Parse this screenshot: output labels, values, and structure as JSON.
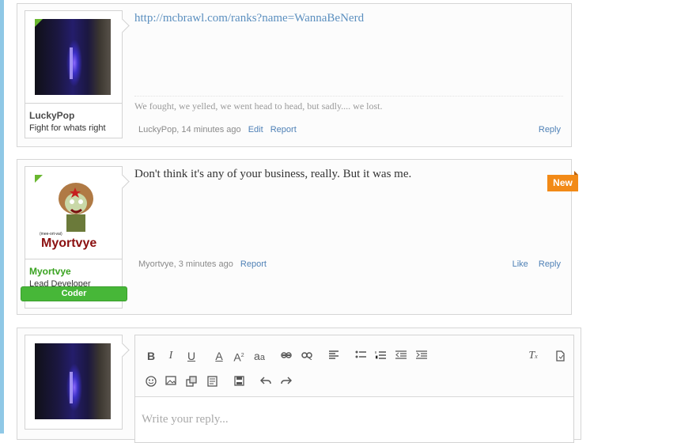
{
  "post1": {
    "username": "LuckyPop",
    "user_title": "Fight for whats right",
    "message_link": "http://mcbrawl.com/ranks?name=WannaBeNerd",
    "signature": "We fought, we yelled, we went head to head, but sadly.... we lost.",
    "meta_author_time": "LuckyPop, 14 minutes ago",
    "edit_label": "Edit",
    "report_label": "Report",
    "reply_label": "Reply"
  },
  "post2": {
    "username": "Myortvye",
    "user_title": "Lead Developer",
    "badge": "Coder",
    "message": "Don't think it's any of your business, really. But it was me.",
    "new_label": "New",
    "meta_author_time": "Myortvye, 3 minutes ago",
    "report_label": "Report",
    "like_label": "Like",
    "reply_label": "Reply",
    "avatar_text": "(mee-ort-vai) Myortvye"
  },
  "reply_editor": {
    "placeholder": "Write your reply...",
    "toolbar_icons": [
      "bold-icon",
      "italic-icon",
      "underline-icon",
      "text-color-icon",
      "font-size-icon",
      "font-family-icon",
      "link-icon",
      "unlink-icon",
      "align-icon",
      "bullet-list-icon",
      "numbered-list-icon",
      "outdent-icon",
      "indent-icon",
      "remove-format-icon",
      "toggle-bbcode-icon",
      "smilie-icon",
      "image-icon",
      "media-icon",
      "code-icon",
      "save-draft-icon",
      "undo-icon",
      "redo-icon"
    ]
  },
  "colors": {
    "link": "#5b8fbf",
    "new_badge": "#f28a17",
    "coder_badge": "#47b738",
    "staff_username": "#3aa321",
    "stripe": "#8fc8e6"
  }
}
